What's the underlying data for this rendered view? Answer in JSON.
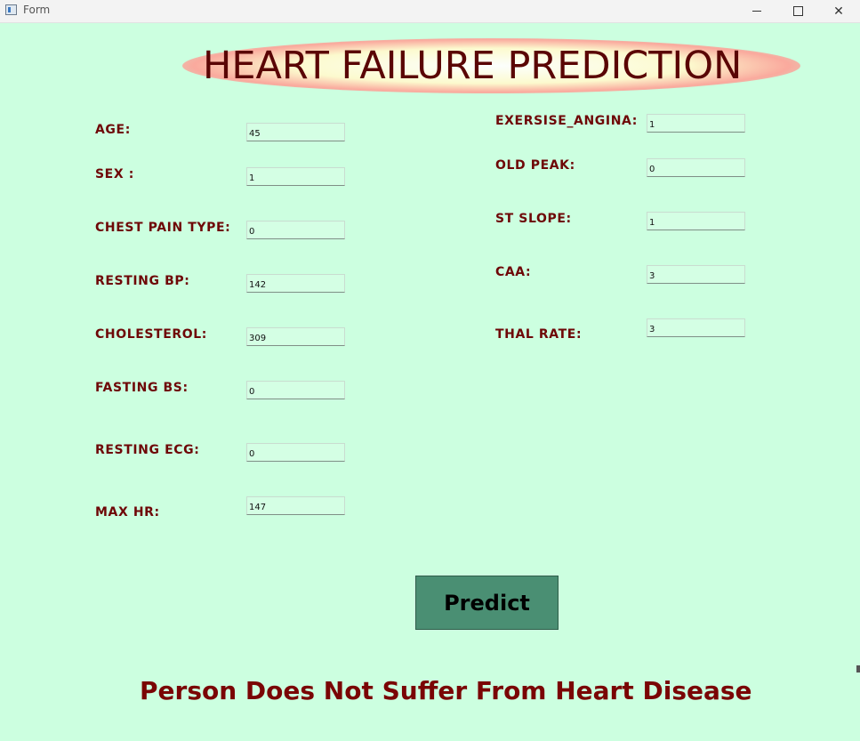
{
  "window": {
    "title": "Form",
    "min_glyph": "—",
    "max_glyph": "□",
    "close_glyph": "✕"
  },
  "heading": "HEART FAILURE PREDICTION",
  "fields": {
    "age": {
      "label": "AGE:",
      "value": "45"
    },
    "sex": {
      "label": "SEX :",
      "value": "1"
    },
    "chest_pain_type": {
      "label": "CHEST PAIN TYPE:",
      "value": "0"
    },
    "resting_bp": {
      "label": "RESTING BP:",
      "value": "142"
    },
    "cholesterol": {
      "label": "CHOLESTEROL:",
      "value": "309"
    },
    "fasting_bs": {
      "label": "FASTING BS:",
      "value": "0"
    },
    "resting_ecg": {
      "label": "RESTING ECG:",
      "value": "0"
    },
    "max_hr": {
      "label": "MAX HR:",
      "value": "147"
    },
    "exercise_angina": {
      "label": "EXERSISE_ANGINA:",
      "value": "1"
    },
    "old_peak": {
      "label": "OLD PEAK:",
      "value": "0"
    },
    "st_slope": {
      "label": "ST SLOPE:",
      "value": "1"
    },
    "caa": {
      "label": "CAA:",
      "value": "3"
    },
    "thal_rate": {
      "label": "THAL RATE:",
      "value": "3"
    }
  },
  "predict_button": {
    "label": "Predict"
  },
  "result_text": "Person Does Not Suffer From Heart Disease",
  "colors": {
    "background": "#ccffe0",
    "label": "#6e0707",
    "button": "#4a8f73",
    "heading": "#5a0505"
  }
}
